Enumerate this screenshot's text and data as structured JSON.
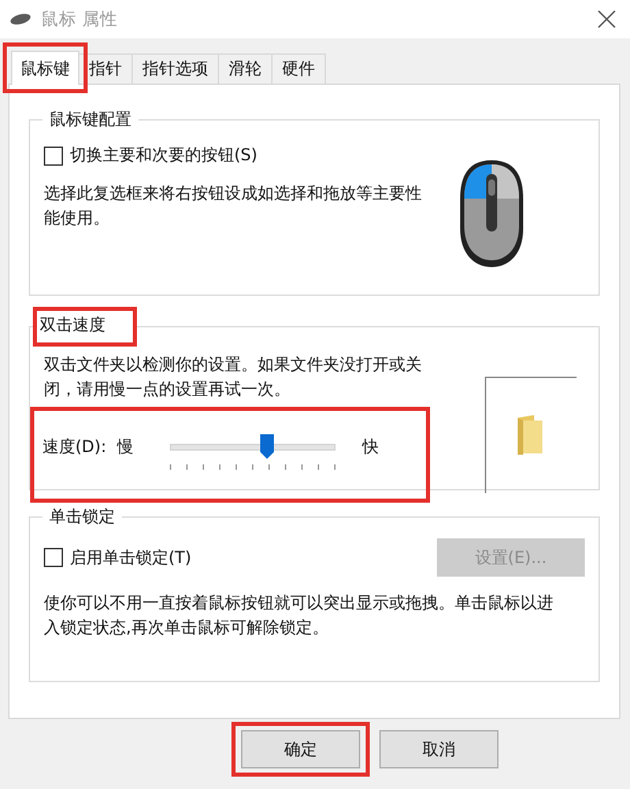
{
  "window": {
    "title": "鼠标 属性"
  },
  "tabs": [
    {
      "label": "鼠标键",
      "selected": true,
      "highlighted": true
    },
    {
      "label": "指针",
      "selected": false,
      "highlighted": false
    },
    {
      "label": "指针选项",
      "selected": false,
      "highlighted": false
    },
    {
      "label": "滑轮",
      "selected": false,
      "highlighted": false
    },
    {
      "label": "硬件",
      "selected": false,
      "highlighted": false
    }
  ],
  "button_config": {
    "legend": "鼠标键配置",
    "checkbox": {
      "label": "切换主要和次要的按钮(S)",
      "checked": false
    },
    "description": "选择此复选框来将右按钮设成如选择和拖放等主要性能使用。"
  },
  "double_click": {
    "legend": "双击速度",
    "legend_highlighted": true,
    "description": "双击文件夹以检测你的设置。如果文件夹没打开或关闭，请用慢一点的设置再试一次。",
    "speed": {
      "label": "速度(D):",
      "slow": "慢",
      "fast": "快",
      "level": 0.59,
      "highlighted": true
    }
  },
  "click_lock": {
    "legend": "单击锁定",
    "checkbox": {
      "label": "启用单击锁定(T)",
      "checked": false
    },
    "settings_button": {
      "label": "设置(E)...",
      "disabled": true
    },
    "description": "使你可以不用一直按着鼠标按钮就可以突出显示或拖拽。单击鼠标以进入锁定状态,再次单击鼠标可解除锁定。"
  },
  "buttons": [
    {
      "label": "确定",
      "highlighted": true
    },
    {
      "label": "取消",
      "highlighted": false
    }
  ]
}
